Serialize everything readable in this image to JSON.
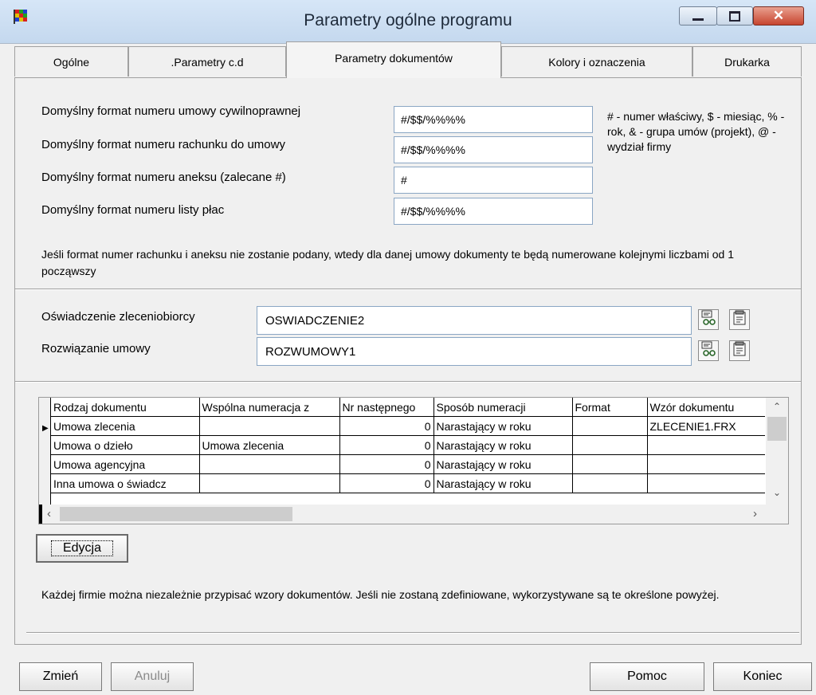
{
  "window": {
    "title": "Parametry ogólne programu"
  },
  "tabs": [
    {
      "label": "Ogólne"
    },
    {
      "label": ".Parametry c.d"
    },
    {
      "label": "Parametry dokumentów"
    },
    {
      "label": "Kolory i oznaczenia"
    },
    {
      "label": "Drukarka"
    }
  ],
  "formats": {
    "rows": [
      {
        "label": "Domyślny format numeru umowy cywilnoprawnej",
        "value": "#/$$/%%%%"
      },
      {
        "label": "Domyślny format numeru rachunku do umowy",
        "value": "#/$$/%%%%"
      },
      {
        "label": "Domyślny format numeru aneksu (zalecane #)",
        "value": "#"
      },
      {
        "label": "Domyślny format numeru listy płac",
        "value": "#/$$/%%%%"
      }
    ],
    "legend": "# - numer właściwy, $ - miesiąc, % - rok, & - grupa umów (projekt), @ - wydział firmy",
    "note": "Jeśli format numer rachunku i aneksu nie zostanie podany, wtedy dla danej umowy dokumenty te będą numerowane kolejnymi liczbami od 1 począwszy"
  },
  "documents": {
    "rows": [
      {
        "label": "Oświadczenie zleceniobiorcy",
        "value": "OSWIADCZENIE2"
      },
      {
        "label": "Rozwiązanie umowy",
        "value": "ROZWUMOWY1"
      }
    ]
  },
  "grid": {
    "columns": [
      "Rodzaj dokumentu",
      "Wspólna numeracja z",
      "Nr następnego",
      "Sposób numeracji",
      "Format",
      "Wzór dokumentu"
    ],
    "rows": [
      [
        "Umowa zlecenia",
        "",
        "0",
        "Narastający w roku",
        "",
        "ZLECENIE1.FRX"
      ],
      [
        "Umowa o dzieło",
        "Umowa zlecenia",
        "0",
        "Narastający w roku",
        "",
        ""
      ],
      [
        "Umowa agencyjna",
        "",
        "0",
        "Narastający w roku",
        "",
        ""
      ],
      [
        "Inna umowa o świadcz",
        "",
        "0",
        "Narastający w roku",
        "",
        ""
      ]
    ]
  },
  "edit_button": "Edycja",
  "footer_note": "Każdej firmie można niezależnie przypisać wzory dokumentów. Jeśli nie zostaną zdefiniowane, wykorzystywane są te określone powyżej.",
  "buttons": {
    "change": "Zmień",
    "cancel": "Anuluj",
    "help": "Pomoc",
    "exit": "Koniec"
  },
  "icons": {
    "app": "app-flag-icon",
    "pick": "glasses-icon",
    "edit": "properties-icon"
  },
  "colors": {
    "titlebar": "#c4d8ee",
    "close": "#c7452f"
  }
}
